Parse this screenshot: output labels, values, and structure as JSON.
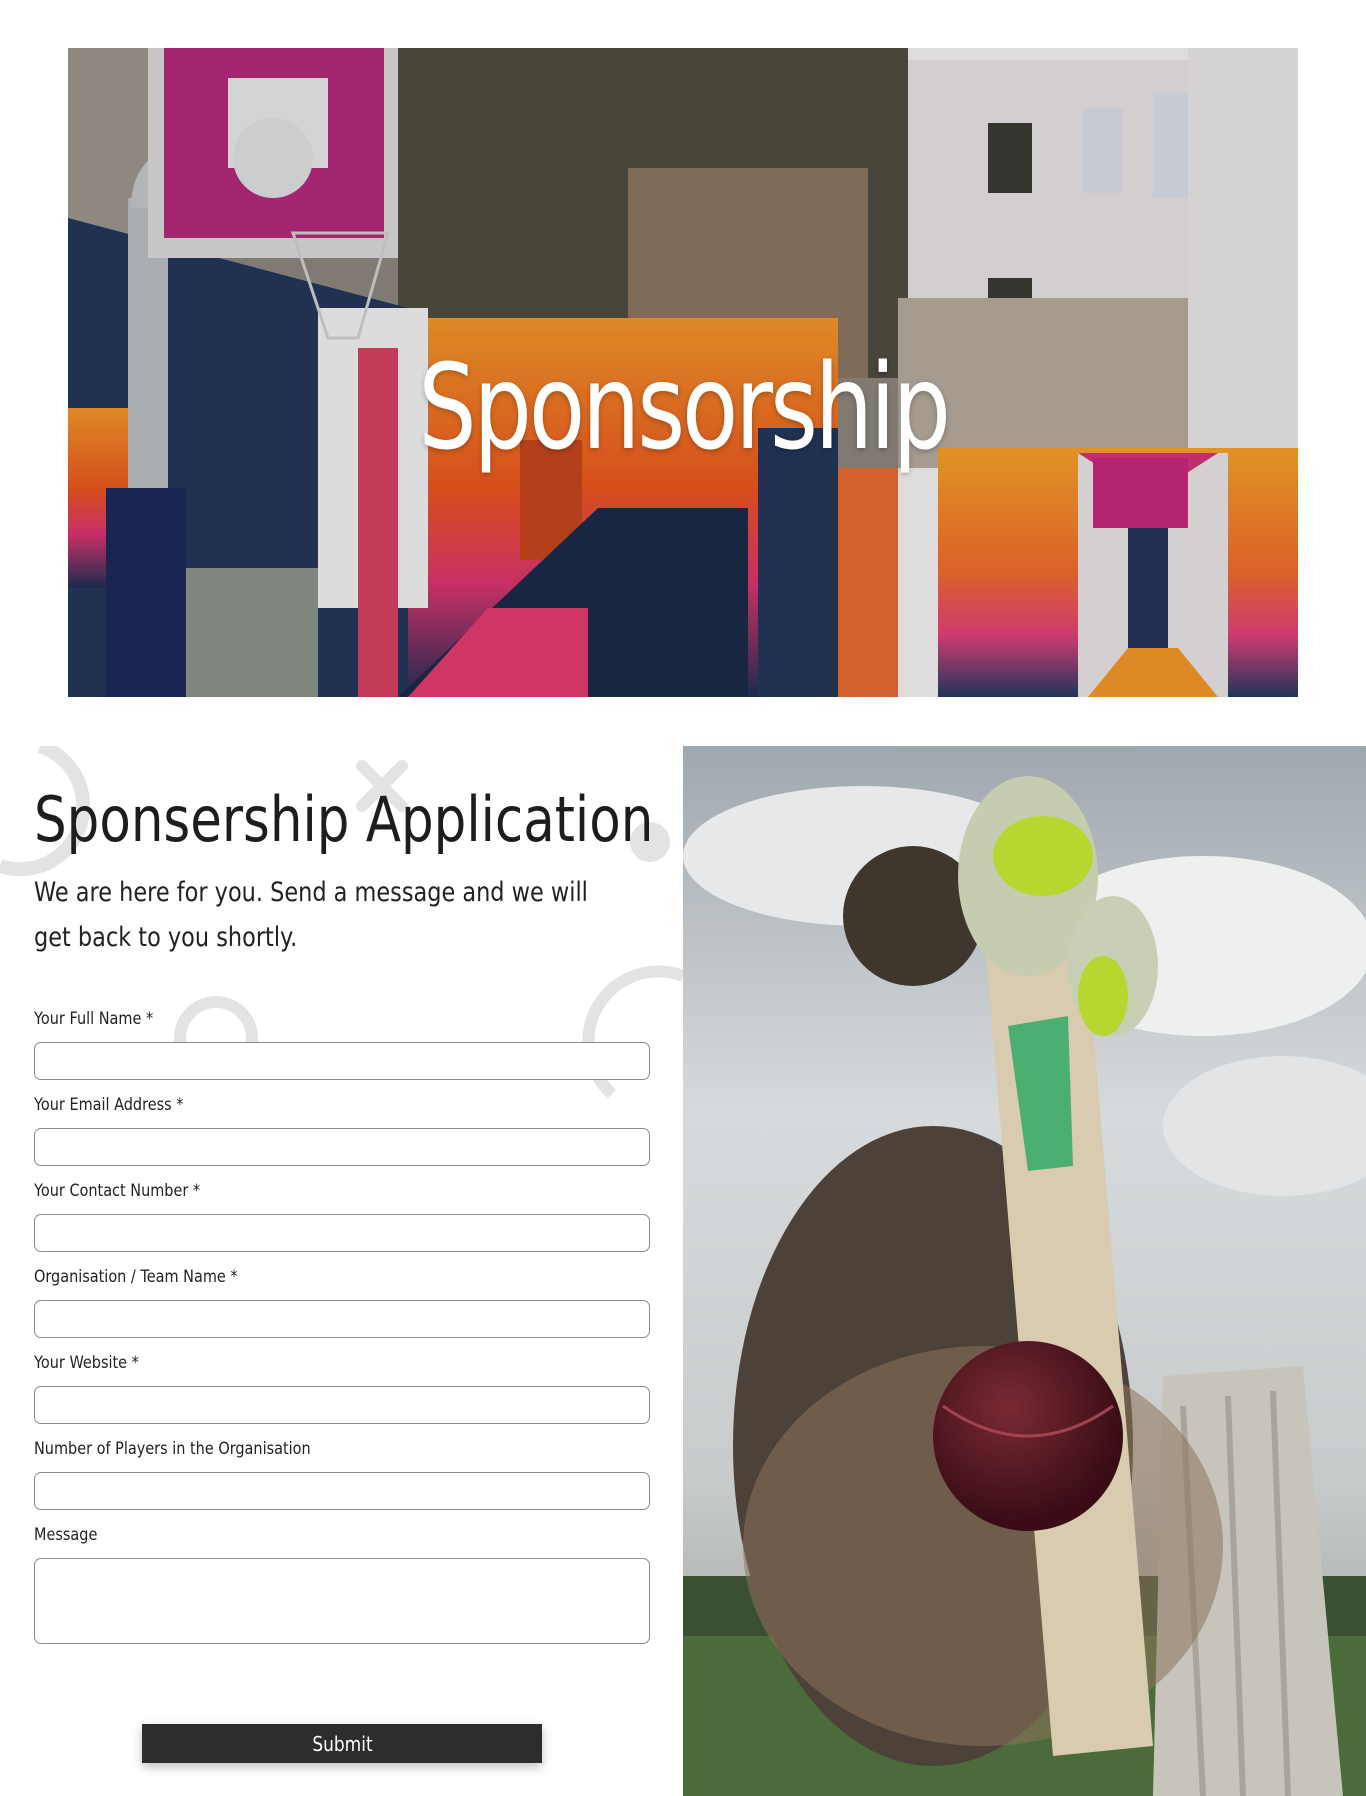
{
  "hero": {
    "title": "Sponsorship",
    "image": "basketball-court-photo"
  },
  "form": {
    "heading": "Sponsership Application",
    "intro": "We are here for you. Send a message and we will get back to you shortly.",
    "fields": [
      {
        "label": "Your Full Name *",
        "value": "",
        "type": "text"
      },
      {
        "label": "Your Email Address *",
        "value": "",
        "type": "email"
      },
      {
        "label": "Your Contact Number *",
        "value": "",
        "type": "tel"
      },
      {
        "label": "Organisation / Team Name *",
        "value": "",
        "type": "text"
      },
      {
        "label": "Your Website *",
        "value": "",
        "type": "url"
      },
      {
        "label": "Number of Players in the Organisation",
        "value": "",
        "type": "text"
      },
      {
        "label": "Message",
        "value": "",
        "type": "textarea"
      }
    ],
    "submit_label": "Submit"
  },
  "side_image": {
    "image": "cricket-batsman-photo"
  },
  "colors": {
    "button_bg": "#2d2d2d",
    "heading": "#1d1d20",
    "input_border": "#8a8a8a",
    "deco_shapes": "#e3e3e3"
  }
}
